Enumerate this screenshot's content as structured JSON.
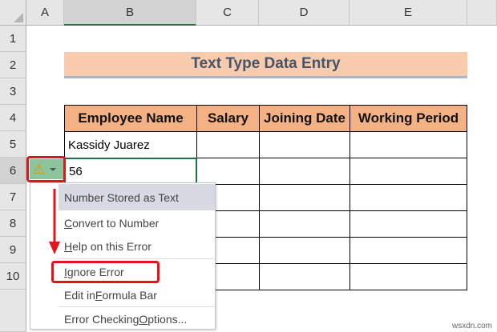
{
  "columns": [
    "A",
    "B",
    "C",
    "D",
    "E"
  ],
  "rows": [
    "1",
    "2",
    "3",
    "4",
    "5",
    "6",
    "7",
    "8",
    "9",
    "10"
  ],
  "title": "Text Type Data Entry",
  "table": {
    "headers": [
      "Employee Name",
      "Salary",
      "Joining Date",
      "Working Period"
    ],
    "b5": "Kassidy Juarez",
    "b6": "56"
  },
  "menu": {
    "header": "Number Stored as Text",
    "items": [
      {
        "pre": "",
        "u": "C",
        "post": "onvert to Number"
      },
      {
        "pre": "",
        "u": "H",
        "post": "elp on this Error"
      },
      {
        "pre": "",
        "u": "I",
        "post": "gnore Error"
      },
      {
        "pre": "Edit in ",
        "u": "F",
        "post": "ormula Bar"
      },
      {
        "pre": "Error Checking ",
        "u": "O",
        "post": "ptions..."
      }
    ]
  },
  "watermark": "wsxdn.com",
  "colors": {
    "header_fill": "#f4b183",
    "title_fill": "#f8cbad",
    "highlight": "#e3141b"
  }
}
